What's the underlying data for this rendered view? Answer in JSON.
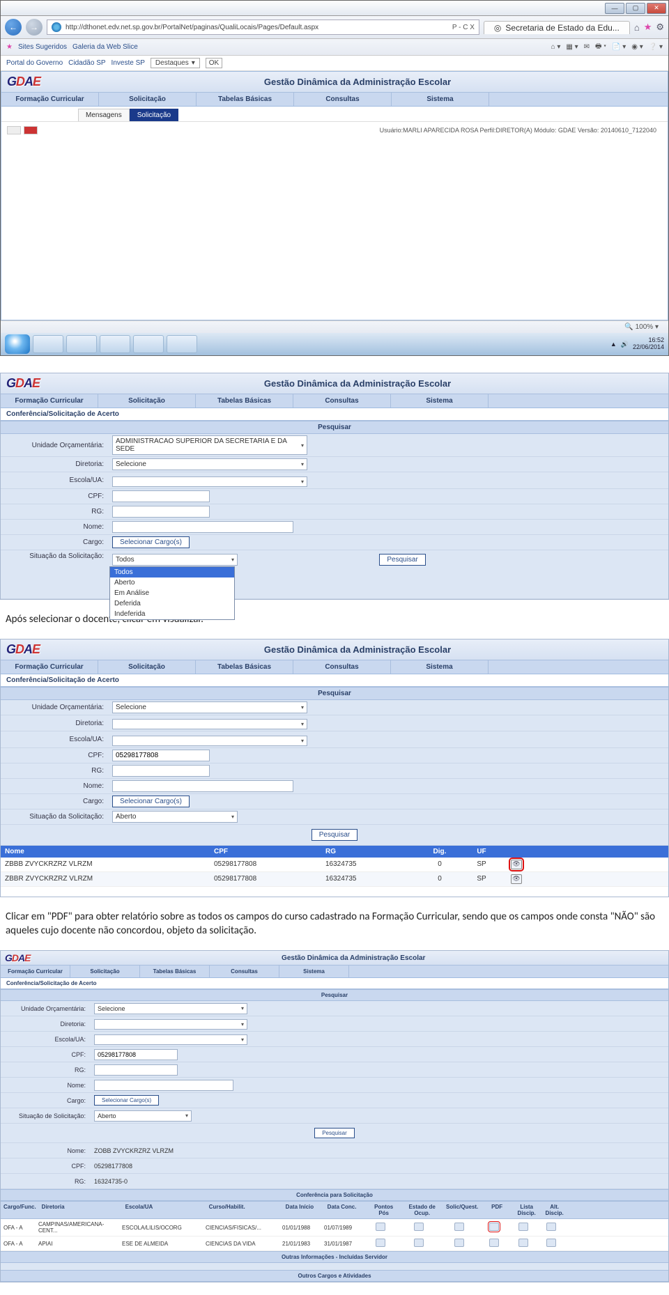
{
  "browser": {
    "url": "http://dthonet.edv.net.sp.gov.br/PortalNet/paginas/QualiLocais/Pages/Default.aspx",
    "search_hint": "P - C X",
    "tab_title": "Secretaria de Estado da Edu...",
    "fav_suggested": "Sites Sugeridos",
    "fav_gallery": "Galeria da Web Slice",
    "link_portal": "Portal do Governo",
    "link_cidadao": "Cidadão SP",
    "link_investe": "Investe SP",
    "link_dest": "Destaques",
    "btn_ok": "OK",
    "zoom": "100%",
    "clock_time": "16:52",
    "clock_date": "22/06/2014"
  },
  "app": {
    "logo_g": "G",
    "logo_d": "D",
    "logo_a": "A",
    "logo_e": "E",
    "title": "Gestão Dinâmica da Administração Escolar",
    "menu": {
      "m1": "Formação Curricular",
      "m2": "Solicitação",
      "m3": "Tabelas Básicas",
      "m4": "Consultas",
      "m5": "Sistema"
    },
    "subtab_msgs": "Mensagens",
    "subtab_solic": "Solicitação",
    "info_line": "Usuário:MARLI APARECIDA ROSA   Perfil:DIRETOR(A)   Módulo: GDAE   Versão: 20140610_7122040"
  },
  "panel2": {
    "crumb": "Conferência/Solicitação de Acerto",
    "sec_pesquisar": "Pesquisar",
    "lbl_uo": "Unidade Orçamentária:",
    "val_uo": "ADMINISTRACAO SUPERIOR DA SECRETARIA E DA SEDE",
    "lbl_diretoria": "Diretoria:",
    "val_diretoria": "Selecione",
    "lbl_escola": "Escola/UA:",
    "lbl_cpf": "CPF:",
    "lbl_rg": "RG:",
    "lbl_nome": "Nome:",
    "lbl_cargo": "Cargo:",
    "btn_cargo": "Selecionar Cargo(s)",
    "lbl_situacao": "Situação da Solicitação:",
    "val_situacao": "Todos",
    "dd_todos": "Todos",
    "dd_aberto": "Aberto",
    "dd_analise": "Em Análise",
    "dd_deferida": "Deferida",
    "dd_indef": "Indeferida",
    "btn_pesquisar": "Pesquisar"
  },
  "text1": "Após selecionar o docente, clicar em visualizar.",
  "panel3": {
    "crumb": "Conferência/Solicitação de Acerto",
    "sec_pesquisar": "Pesquisar",
    "lbl_uo": "Unidade Orçamentária:",
    "val_uo": "Selecione",
    "lbl_diretoria": "Diretoria:",
    "lbl_escola": "Escola/UA:",
    "lbl_cpf": "CPF:",
    "val_cpf": "05298177808",
    "lbl_rg": "RG:",
    "lbl_nome": "Nome:",
    "lbl_cargo": "Cargo:",
    "btn_cargo": "Selecionar Cargo(s)",
    "lbl_situacao": "Situação da Solicitação:",
    "val_situacao": "Aberto",
    "btn_pesquisar": "Pesquisar",
    "th_nome": "Nome",
    "th_cpf": "CPF",
    "th_rg": "RG",
    "th_dig": "Dig.",
    "th_uf": "UF",
    "rows": [
      {
        "nome": "ZBBB ZVYCKRZRZ VLRZM",
        "cpf": "05298177808",
        "rg": "16324735",
        "dig": "0",
        "uf": "SP"
      },
      {
        "nome": "ZBBR ZVYCKRZRZ VLRZM",
        "cpf": "05298177808",
        "rg": "16324735",
        "dig": "0",
        "uf": "SP"
      }
    ]
  },
  "text2": "Clicar em \"PDF\" para obter relatório sobre as todos os campos do curso cadastrado na Formação Curricular, sendo que os campos onde consta \"NÃO\" são aqueles cujo docente não concordou, objeto da solicitação.",
  "panel4": {
    "crumb": "Conferência/Solicitação de Acerto",
    "sec_pesquisar": "Pesquisar",
    "lbl_uo": "Unidade Orçamentária:",
    "val_uo": "Selecione",
    "lbl_diretoria": "Diretoria:",
    "lbl_escola": "Escola/UA:",
    "lbl_cpf": "CPF:",
    "val_cpf": "05298177808",
    "lbl_rg": "RG:",
    "lbl_nome": "Nome:",
    "lbl_cargo": "Cargo:",
    "btn_cargo": "Selecionar Cargo(s)",
    "lbl_situacao": "Situação de Solicitação:",
    "val_situacao": "Aberto",
    "btn_pesquisar": "Pesquisar",
    "result_header": "Conferência para Solicitação",
    "lbl_nome2": "Nome:",
    "val_nome2": "ZOBB ZVYCKRZRZ VLRZM",
    "lbl_cpf2": "CPF:",
    "val_cpf2": "05298177808",
    "lbl_rg2": "RG:",
    "val_rg2": "16324735-0",
    "th": {
      "c1": "Cargo/Func.",
      "c2": "Diretoria",
      "c3": "Escola/UA",
      "c4": "Curso/Habilit.",
      "c5": "Data Início",
      "c6": "Data Conc.",
      "c7": "Pontos Pós",
      "c8": "Estado de Ocup.",
      "c9": "Solic/Quest.",
      "c10": "PDF",
      "c11": "Lista Discip.",
      "c12": "Alt. Discip."
    },
    "rows": [
      {
        "c1": "OFA - A",
        "c2": "CAMPINAS/AMERICANA-CENT...",
        "c3": "ESCOLA/LILIS/OCORG",
        "c4": "CIENCIAS/FISICAS/...",
        "c5": "01/01/1988",
        "c6": "01/07/1989"
      },
      {
        "c1": "OFA - A",
        "c2": "APIAI",
        "c3": "ESE DE ALMEIDA",
        "c4": "CIENCIAS DA VIDA",
        "c5": "21/01/1983",
        "c6": "31/01/1987"
      }
    ],
    "footer1": "Outras Informações - Incluídas Servidor",
    "footer2": "Outros Cargos e Atividades"
  }
}
